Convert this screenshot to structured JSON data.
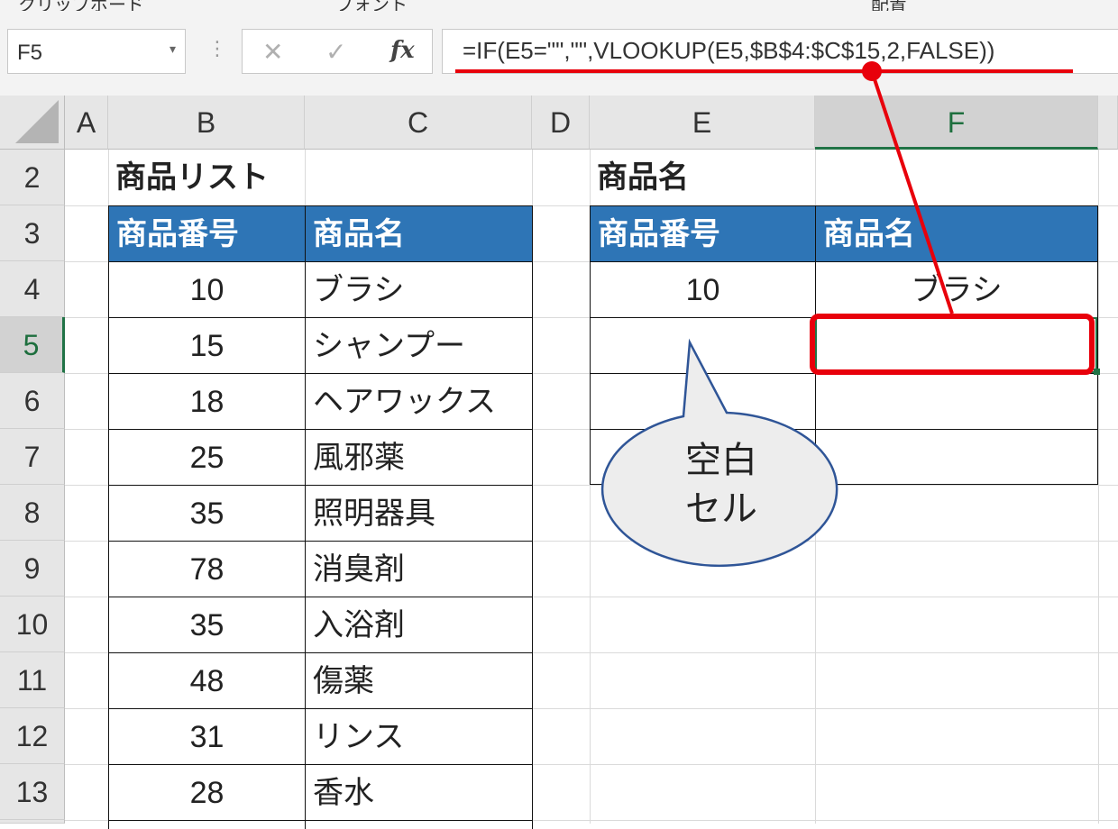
{
  "ribbon": {
    "groups": [
      "クリップボード",
      "フォント",
      "配置"
    ]
  },
  "formula_bar": {
    "name_box": "F5",
    "name_box_dropdown_icon": "chevron-down-icon",
    "cancel_glyph": "✕",
    "enter_glyph": "✓",
    "fx_label": "fx",
    "formula": "=IF(E5=\"\",\"\",VLOOKUP(E5,$B$4:$C$15,2,FALSE))"
  },
  "columns": [
    "A",
    "B",
    "C",
    "D",
    "E",
    "F"
  ],
  "selected_column": "F",
  "rows": [
    "2",
    "3",
    "4",
    "5",
    "6",
    "7",
    "8",
    "9",
    "10",
    "11",
    "12",
    "13"
  ],
  "selected_row": "5",
  "product_list": {
    "title": "商品リスト",
    "header_number": "商品番号",
    "header_name": "商品名",
    "items": [
      {
        "number": "10",
        "name": "ブラシ"
      },
      {
        "number": "15",
        "name": "シャンプー"
      },
      {
        "number": "18",
        "name": "ヘアワックス"
      },
      {
        "number": "25",
        "name": "風邪薬"
      },
      {
        "number": "35",
        "name": "照明器具"
      },
      {
        "number": "78",
        "name": "消臭剤"
      },
      {
        "number": "35",
        "name": "入浴剤"
      },
      {
        "number": "48",
        "name": "傷薬"
      },
      {
        "number": "31",
        "name": "リンス"
      },
      {
        "number": "28",
        "name": "香水"
      }
    ]
  },
  "lookup_table": {
    "title": "商品名",
    "header_number": "商品番号",
    "header_name": "商品名",
    "rows": [
      {
        "number": "10",
        "name": "ブラシ"
      },
      {
        "number": "",
        "name": ""
      },
      {
        "number": "",
        "name": ""
      },
      {
        "number": "",
        "name": ""
      }
    ]
  },
  "annotation": {
    "callout_line1": "空白",
    "callout_line2": "セル",
    "highlight_color": "#e8000b",
    "header_fill_color": "#2e75b6",
    "selection_color": "#217346"
  }
}
